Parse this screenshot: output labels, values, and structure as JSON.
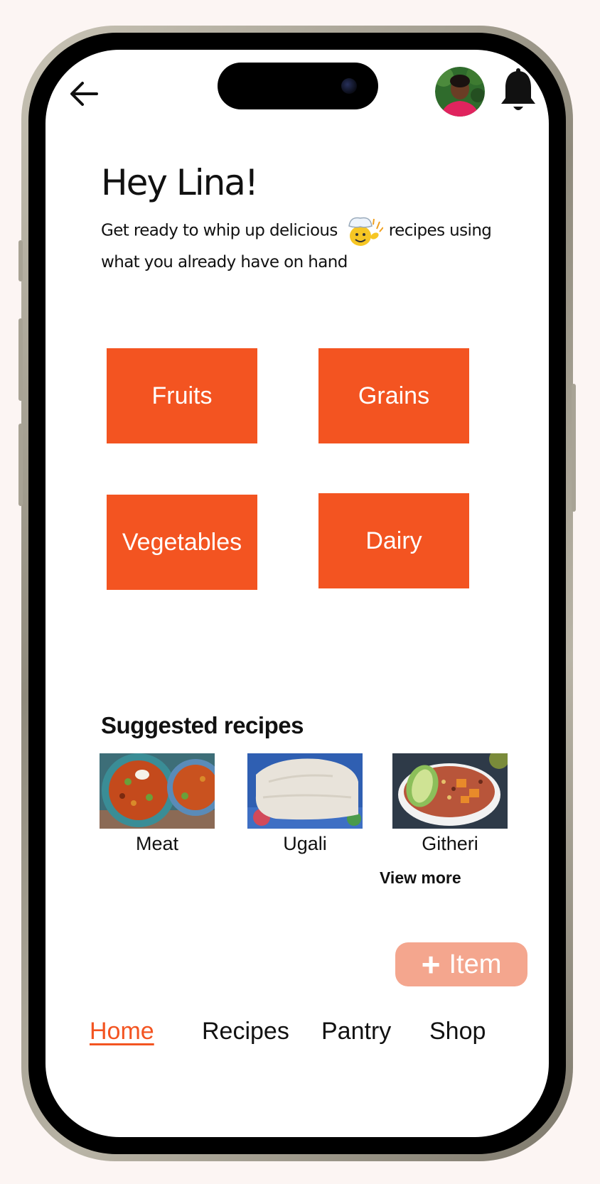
{
  "header": {
    "back_icon": "arrow-left-icon",
    "avatar_icon": "user-avatar",
    "bell_icon": "bell-icon"
  },
  "greeting": {
    "title": "Hey Lina!",
    "subtitle_part1": "Get ready to whip up delicious",
    "subtitle_part2": "recipes using what you already have on hand",
    "emoji_icon": "chef-emoji-icon"
  },
  "categories": [
    "Fruits",
    "Grains",
    "Vegetables",
    "Dairy"
  ],
  "suggested": {
    "title": "Suggested recipes",
    "items": [
      "Meat",
      "Ugali",
      "Githeri"
    ],
    "view_more": "View more"
  },
  "add_item": {
    "icon": "plus-icon",
    "label": "Item"
  },
  "nav": {
    "items": [
      "Home",
      "Recipes",
      "Pantry",
      "Shop"
    ],
    "active": "Home"
  },
  "colors": {
    "accent": "#f35421",
    "accent_light": "#f4a68e",
    "background": "#fcf5f3"
  }
}
